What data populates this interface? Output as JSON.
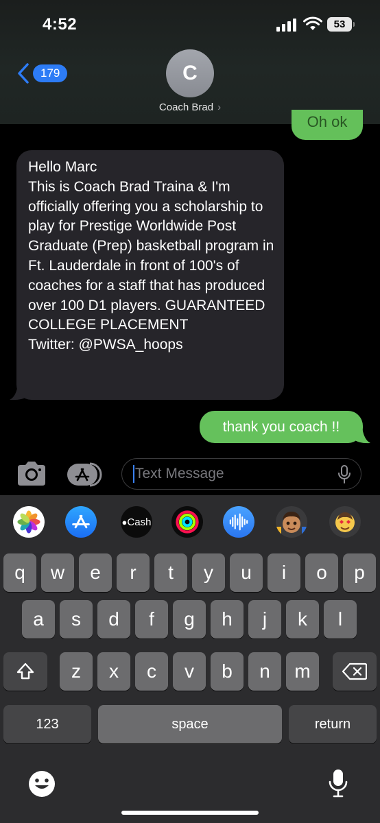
{
  "status_bar": {
    "time": "4:52",
    "battery": "53",
    "icons": [
      "signal-icon",
      "wifi-icon",
      "battery-icon"
    ]
  },
  "header": {
    "back_count": "179",
    "avatar_initial": "C",
    "contact_name": "Coach Brad",
    "chevron": "›"
  },
  "messages": {
    "partial_top_text": "Oh ok",
    "incoming": "Hello Marc\nThis is Coach Brad Traina & I'm officially offering you a scholarship to play for Prestige Worldwide Post Graduate (Prep) basketball program in Ft. Lauderdale in front of 100's of coaches for a staff that has produced over 100 D1 players. GUARANTEED COLLEGE PLACEMENT\nTwitter: @PWSA_hoops",
    "outgoing": "thank you coach !!"
  },
  "compose": {
    "placeholder": "Text Message"
  },
  "app_strip": {
    "cash_label": "Cash",
    "items": [
      "photos-app-icon",
      "app-store-icon",
      "apple-cash-icon",
      "activity-icon",
      "audio-message-icon",
      "memoji-icon",
      "memoji-stickers-icon"
    ]
  },
  "keyboard": {
    "row1": [
      "q",
      "w",
      "e",
      "r",
      "t",
      "y",
      "u",
      "i",
      "o",
      "p"
    ],
    "row2": [
      "a",
      "s",
      "d",
      "f",
      "g",
      "h",
      "j",
      "k",
      "l"
    ],
    "row3": [
      "z",
      "x",
      "c",
      "v",
      "b",
      "n",
      "m"
    ],
    "numbers_label": "123",
    "space_label": "space",
    "return_label": "return"
  },
  "colors": {
    "sent_bubble": "#65c15c",
    "received_bubble": "#26252a",
    "accent_blue": "#2d7cf6",
    "keyboard_bg": "#2c2c2e",
    "key": "#6c6c6e"
  }
}
